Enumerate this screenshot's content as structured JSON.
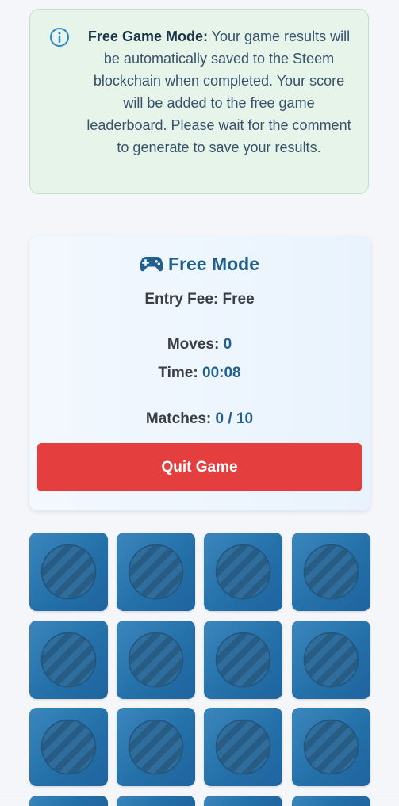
{
  "notice": {
    "icon": "info-circle-icon",
    "title": "Free Game Mode:",
    "message": "Your game results will be automatically saved to the Steem blockchain when completed. Your score will be added to the free game leaderboard. Please wait for the comment to generate to save your results."
  },
  "game": {
    "mode_icon": "gamepad-icon",
    "mode_title": "Free Mode",
    "entry_fee_label": "Entry Fee:",
    "entry_fee_value": "Free",
    "moves_label": "Moves:",
    "moves_value": "0",
    "time_label": "Time:",
    "time_value": "00:08",
    "matches_label": "Matches:",
    "matches_value": "0 / 10",
    "quit_label": "Quit Game"
  },
  "board": {
    "card_back_icon": "striped-circle-icon",
    "visible_cards": 16,
    "colors": {
      "card": "#2a75ae",
      "quit": "#e53e3e",
      "accent": "#215f8c",
      "notice_bg": "#e6f4ea"
    }
  }
}
